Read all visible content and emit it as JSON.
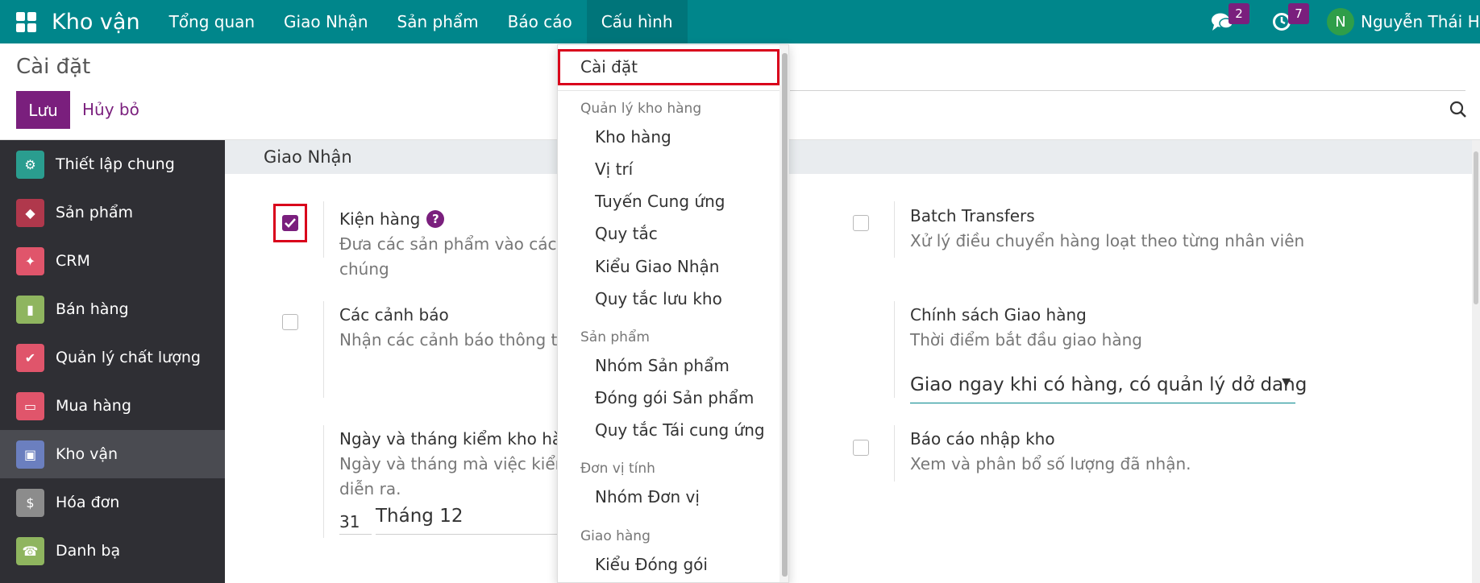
{
  "nav": {
    "brand": "Kho vận",
    "items": [
      "Tổng quan",
      "Giao Nhận",
      "Sản phẩm",
      "Báo cáo",
      "Cấu hình"
    ],
    "messages_count": "2",
    "activities_count": "7",
    "avatar_letter": "N",
    "user_name": "Nguyễn Thái H"
  },
  "control": {
    "breadcrumb": "Cài đặt",
    "save_label": "Lưu",
    "cancel_label": "Hủy bỏ"
  },
  "sidebar": {
    "items": [
      {
        "label": "Thiết lập chung",
        "color": "#2a9d8f"
      },
      {
        "label": "Sản phẩm",
        "color": "#b0384c"
      },
      {
        "label": "CRM",
        "color": "#e0556b"
      },
      {
        "label": "Bán hàng",
        "color": "#8fb55f"
      },
      {
        "label": "Quản lý chất lượng",
        "color": "#e0556b"
      },
      {
        "label": "Mua hàng",
        "color": "#e0556b"
      },
      {
        "label": "Kho vận",
        "color": "#6b7fbf"
      },
      {
        "label": "Hóa đơn",
        "color": "#8c8c8c"
      },
      {
        "label": "Danh bạ",
        "color": "#8fb55f"
      }
    ]
  },
  "main": {
    "section_title": "Giao Nhận",
    "packages": {
      "title": "Kiện hàng",
      "desc1": "Đưa các sản phẩm vào các g",
      "desc2": "chúng"
    },
    "batch": {
      "title": "Batch Transfers",
      "desc": "Xử lý điều chuyển hàng loạt theo từng nhân viên"
    },
    "warnings": {
      "title": "Các cảnh báo",
      "desc": "Nhận các cảnh báo thông tin"
    },
    "delivery_policy": {
      "title": "Chính sách Giao hàng",
      "desc": "Thời điểm bắt đầu giao hàng",
      "value": "Giao ngay khi có hàng, có quản lý dở dang"
    },
    "inventory_date": {
      "title": "Ngày và tháng kiểm kho hàng",
      "desc1": "Ngày và tháng mà việc kiểm",
      "desc2": "diễn ra.",
      "day": "31",
      "month": "Tháng 12"
    },
    "receipt_report": {
      "title": "Báo cáo nhập kho",
      "desc": "Xem và phân bổ số lượng đã nhận."
    }
  },
  "dropdown": {
    "settings": "Cài đặt",
    "h_warehouse": "Quản lý kho hàng",
    "warehouses": "Kho hàng",
    "locations": "Vị trí",
    "routes": "Tuyến Cung ứng",
    "rules": "Quy tắc",
    "op_types": "Kiểu Giao Nhận",
    "putaway": "Quy tắc lưu kho",
    "h_products": "Sản phẩm",
    "categories": "Nhóm Sản phẩm",
    "packagings": "Đóng gói Sản phẩm",
    "reorder": "Quy tắc Tái cung ứng",
    "h_uom": "Đơn vị tính",
    "uom_cat": "Nhóm Đơn vị",
    "h_delivery": "Giao hàng",
    "pkg_types": "Kiểu Đóng gói"
  }
}
